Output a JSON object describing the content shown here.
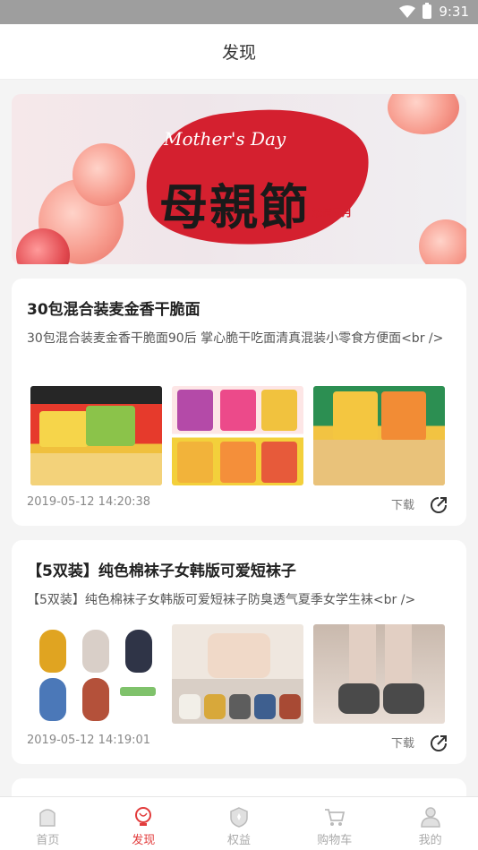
{
  "status_bar": {
    "time": "9:31"
  },
  "header": {
    "title": "发现"
  },
  "banner": {
    "en_text": "Mother's Day",
    "cn_text": "母親節",
    "stamp_text": "浓情五月"
  },
  "posts": [
    {
      "title": "30包混合装麦金香干脆面",
      "description": "30包混合装麦金香干脆面90后 掌心脆干吃面清真混装小零食方便面<br />",
      "images": [
        "snack-pack-photo",
        "snack-flavors-photo",
        "snack-noodles-photo"
      ],
      "date": "2019-05-12 14:20:38",
      "download_label": "下载"
    },
    {
      "title": "【5双装】纯色棉袜子女韩版可爱短袜子",
      "description": "【5双装】纯色棉袜子女韩版可爱短袜子防臭透气夏季女学生袜<br />",
      "images": [
        "sock-colors-photo",
        "sock-model-photo",
        "sock-worn-photo"
      ],
      "date": "2019-05-12 14:19:01",
      "download_label": "下载"
    }
  ],
  "tabbar": {
    "items": [
      {
        "label": "首页",
        "icon": "home-icon"
      },
      {
        "label": "发现",
        "icon": "discover-bulb-icon",
        "active": true
      },
      {
        "label": "权益",
        "icon": "rights-shield-icon"
      },
      {
        "label": "购物车",
        "icon": "cart-icon"
      },
      {
        "label": "我的",
        "icon": "profile-icon"
      }
    ]
  },
  "colors": {
    "accent": "#e23c3c",
    "status_bar": "#9e9e9e",
    "background": "#f4f4f4"
  }
}
